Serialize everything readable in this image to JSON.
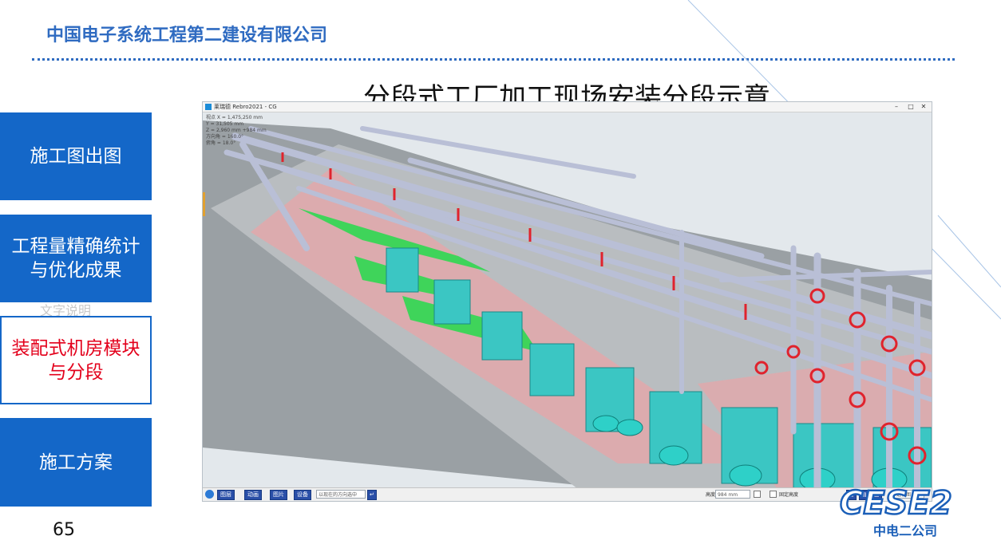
{
  "header": {
    "company_name": "中国电子系统工程第二建设有限公司"
  },
  "slide": {
    "title": "分段式工厂加工现场安装分段示意",
    "page_number": "65",
    "ghost_text": "文字说明"
  },
  "nav": {
    "items": [
      {
        "label": "施工图出图",
        "active": false
      },
      {
        "label": "工程量精确统计与优化成果",
        "active": false
      },
      {
        "label": "装配式机房模块与分段",
        "active": true
      },
      {
        "label": "施工方案",
        "active": false
      }
    ]
  },
  "app": {
    "window_title": "莱瑞德 Rebro2021 - CG",
    "hud_lines": [
      "视点 X = 1,475,250 mm",
      "Y = 31,505 mm",
      "Z = 2,960 mm +984 mm",
      "方向角 = 160.0°",
      "俯角 = 18.0°"
    ],
    "toolbar": {
      "buttons": [
        "图层",
        "动画",
        "图片",
        "设备"
      ],
      "direction_placeholder": "以现在的方向选中",
      "height_label": "高度",
      "height_value": "984 mm",
      "fix_height_label": "固定高度",
      "mode_select": "透视图"
    }
  },
  "branding": {
    "logo_text": "CESE2",
    "company_short": "中电二公司"
  },
  "colors": {
    "accent": "#1467c8",
    "header": "#2f6bc1",
    "active_text": "#e3001b"
  }
}
